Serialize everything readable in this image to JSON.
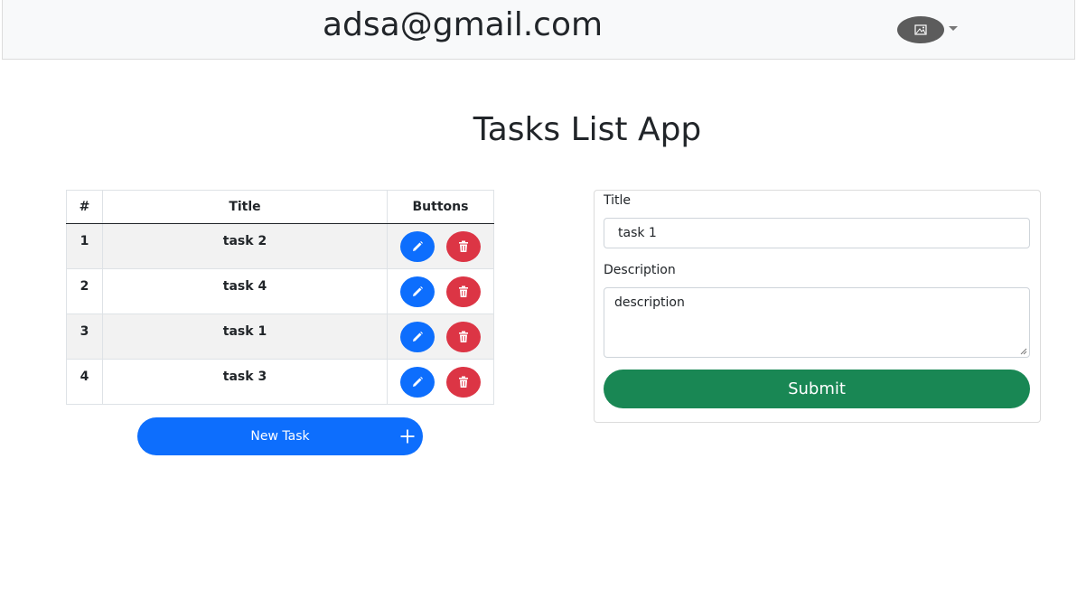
{
  "header": {
    "email": "adsa@gmail.com",
    "avatar_icon": "image-icon"
  },
  "page": {
    "title": "Tasks List App"
  },
  "table": {
    "headers": {
      "index": "#",
      "title": "Title",
      "buttons": "Buttons"
    },
    "rows": [
      {
        "index": "1",
        "title": "task 2"
      },
      {
        "index": "2",
        "title": "task 4"
      },
      {
        "index": "3",
        "title": "task 1"
      },
      {
        "index": "4",
        "title": "task 3"
      }
    ],
    "edit_icon": "pencil-icon",
    "delete_icon": "trash-icon"
  },
  "new_task": {
    "label": "New Task",
    "icon": "plus-icon"
  },
  "form": {
    "title_label": "Title",
    "title_value": "task 1",
    "description_label": "Description",
    "description_value": "description",
    "submit_label": "Submit"
  },
  "colors": {
    "primary": "#0d6efd",
    "danger": "#dc3545",
    "success": "#198754",
    "navbar": "#f8f9fa"
  }
}
